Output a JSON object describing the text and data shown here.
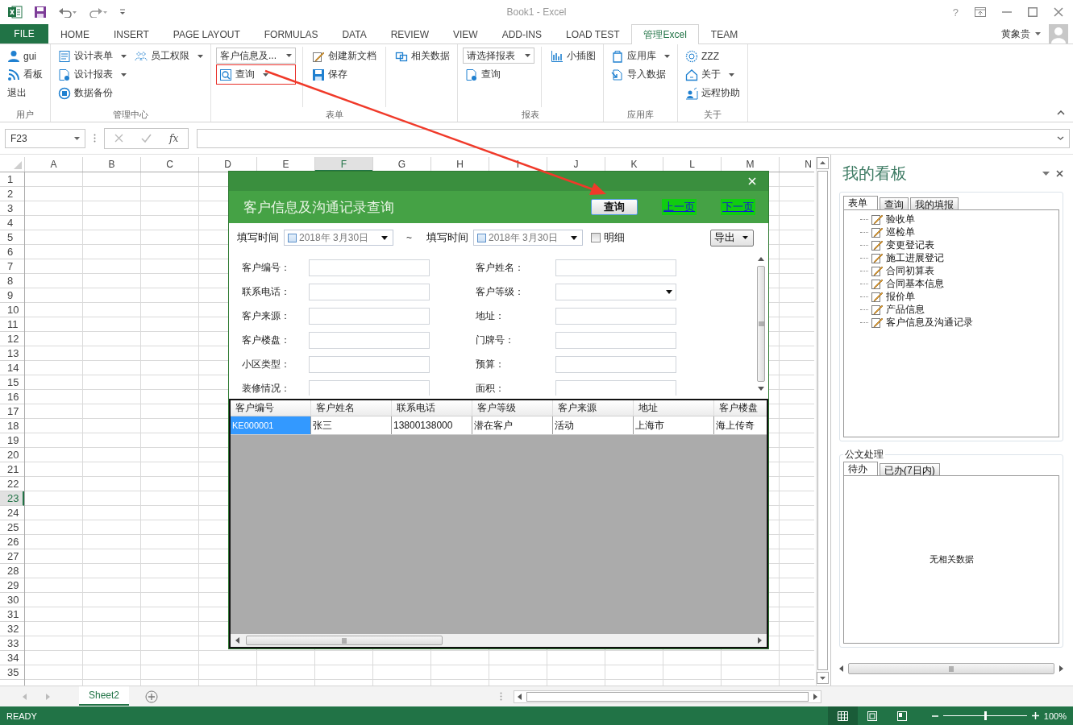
{
  "window": {
    "title": "Book1 - Excel",
    "help": "?"
  },
  "ribbon_tabs": [
    {
      "label": "FILE",
      "kind": "backstage",
      "selected": false
    },
    {
      "label": "HOME",
      "kind": "tab",
      "selected": false
    },
    {
      "label": "INSERT",
      "kind": "tab",
      "selected": false
    },
    {
      "label": "PAGE LAYOUT",
      "kind": "tab",
      "selected": false
    },
    {
      "label": "FORMULAS",
      "kind": "tab",
      "selected": false
    },
    {
      "label": "DATA",
      "kind": "tab",
      "selected": false
    },
    {
      "label": "REVIEW",
      "kind": "tab",
      "selected": false
    },
    {
      "label": "VIEW",
      "kind": "tab",
      "selected": false
    },
    {
      "label": "ADD-INS",
      "kind": "tab",
      "selected": false
    },
    {
      "label": "LOAD TEST",
      "kind": "tab",
      "selected": false
    },
    {
      "label": "管理Excel",
      "kind": "tab",
      "selected": true
    },
    {
      "label": "TEAM",
      "kind": "tab",
      "selected": false
    }
  ],
  "account": {
    "name": "黄象贵"
  },
  "ribbon_groups": [
    {
      "label": "用户",
      "columns": [
        [
          {
            "kind": "button",
            "label": "gui",
            "has_menu": false
          },
          {
            "kind": "button",
            "label": "看板",
            "has_menu": false
          },
          {
            "kind": "button",
            "label": "退出",
            "has_menu": false
          }
        ]
      ]
    },
    {
      "label": "管理中心",
      "column_dividers": false,
      "columns": [
        [
          {
            "kind": "button",
            "label": "设计表单",
            "has_menu": true
          },
          {
            "kind": "button",
            "label": "设计报表",
            "has_menu": true
          },
          {
            "kind": "button",
            "label": "数据备份",
            "has_menu": false
          }
        ],
        [
          {
            "kind": "button",
            "label": "员工权限",
            "has_menu": true
          }
        ]
      ]
    },
    {
      "label": "表单",
      "column_dividers": true,
      "columns": [
        [
          {
            "kind": "combo",
            "label": "客户信息及...",
            "has_menu": true
          },
          {
            "kind": "button",
            "label": "查询",
            "has_menu": true
          }
        ],
        [
          {
            "kind": "button",
            "label": "创建新文档",
            "has_menu": false
          },
          {
            "kind": "button",
            "label": "保存",
            "has_menu": false
          }
        ],
        [
          {
            "kind": "button",
            "label": "相关数据",
            "has_menu": false
          }
        ]
      ]
    },
    {
      "label": "报表",
      "column_dividers": true,
      "columns": [
        [
          {
            "kind": "combo",
            "label": "请选择报表",
            "has_menu": true
          },
          {
            "kind": "button",
            "label": "查询",
            "has_menu": false
          }
        ],
        [
          {
            "kind": "button",
            "label": "小插图",
            "has_menu": false
          }
        ]
      ]
    },
    {
      "label": "应用库",
      "columns": [
        [
          {
            "kind": "button",
            "label": "应用库",
            "has_menu": true
          },
          {
            "kind": "button",
            "label": "导入数据",
            "has_menu": false
          }
        ]
      ]
    },
    {
      "label": "关于",
      "columns": [
        [
          {
            "kind": "button",
            "label": "ZZZ",
            "has_menu": false
          },
          {
            "kind": "button",
            "label": "关于",
            "has_menu": true
          },
          {
            "kind": "button",
            "label": "远程协助",
            "has_menu": false
          }
        ]
      ]
    }
  ],
  "annotation": {
    "shown": true
  },
  "formula_bar": {
    "cell_name": "F23",
    "function_label": "fx"
  },
  "sheet": {
    "columns": [
      {
        "label": "A",
        "selected": false
      },
      {
        "label": "B",
        "selected": false
      },
      {
        "label": "C",
        "selected": false
      },
      {
        "label": "D",
        "selected": false
      },
      {
        "label": "E",
        "selected": false
      },
      {
        "label": "F",
        "selected": true
      },
      {
        "label": "G",
        "selected": false
      },
      {
        "label": "H",
        "selected": false
      },
      {
        "label": "I",
        "selected": false
      },
      {
        "label": "J",
        "selected": false
      },
      {
        "label": "K",
        "selected": false
      },
      {
        "label": "L",
        "selected": false
      },
      {
        "label": "M",
        "selected": false
      },
      {
        "label": "N",
        "selected": false
      }
    ],
    "rows": [
      {
        "label": "1",
        "selected": false
      },
      {
        "label": "2",
        "selected": false
      },
      {
        "label": "3",
        "selected": false
      },
      {
        "label": "4",
        "selected": false
      },
      {
        "label": "5",
        "selected": false
      },
      {
        "label": "6",
        "selected": false
      },
      {
        "label": "7",
        "selected": false
      },
      {
        "label": "8",
        "selected": false
      },
      {
        "label": "9",
        "selected": false
      },
      {
        "label": "10",
        "selected": false
      },
      {
        "label": "11",
        "selected": false
      },
      {
        "label": "12",
        "selected": false
      },
      {
        "label": "13",
        "selected": false
      },
      {
        "label": "14",
        "selected": false
      },
      {
        "label": "15",
        "selected": false
      },
      {
        "label": "16",
        "selected": false
      },
      {
        "label": "17",
        "selected": false
      },
      {
        "label": "18",
        "selected": false
      },
      {
        "label": "19",
        "selected": false
      },
      {
        "label": "20",
        "selected": false
      },
      {
        "label": "21",
        "selected": false
      },
      {
        "label": "22",
        "selected": false
      },
      {
        "label": "23",
        "selected": true
      },
      {
        "label": "24",
        "selected": false
      },
      {
        "label": "25",
        "selected": false
      },
      {
        "label": "26",
        "selected": false
      },
      {
        "label": "27",
        "selected": false
      },
      {
        "label": "28",
        "selected": false
      },
      {
        "label": "29",
        "selected": false
      },
      {
        "label": "30",
        "selected": false
      },
      {
        "label": "31",
        "selected": false
      },
      {
        "label": "32",
        "selected": false
      },
      {
        "label": "33",
        "selected": false
      },
      {
        "label": "34",
        "selected": false
      },
      {
        "label": "35",
        "selected": false
      }
    ]
  },
  "dialog": {
    "title": "客户信息及沟通记录查询",
    "query_button": "查询",
    "prev_link": "上一页",
    "next_link": "下一页",
    "date_filters": [
      {
        "label": "填写时间",
        "value": "2018年  3月30日",
        "checked": false
      },
      {
        "label": "填写时间",
        "value": "2018年  3月30日",
        "checked": false
      }
    ],
    "range_separator": "~",
    "detail_checkbox": {
      "label": "明细",
      "checked": false
    },
    "export_button": "导出",
    "field_rows": [
      [
        {
          "label": "客户编号：",
          "kind": "text"
        },
        {
          "label": "客户姓名：",
          "kind": "text"
        }
      ],
      [
        {
          "label": "联系电话：",
          "kind": "text"
        },
        {
          "label": "客户等级：",
          "kind": "select"
        }
      ],
      [
        {
          "label": "客户来源：",
          "kind": "text"
        },
        {
          "label": "地址：",
          "kind": "text"
        }
      ],
      [
        {
          "label": "客户楼盘：",
          "kind": "text"
        },
        {
          "label": "门牌号：",
          "kind": "text"
        }
      ],
      [
        {
          "label": "小区类型：",
          "kind": "text"
        },
        {
          "label": "预算：",
          "kind": "text"
        }
      ],
      [
        {
          "label": "装修情况：",
          "kind": "text"
        },
        {
          "label": "面积：",
          "kind": "text"
        }
      ]
    ],
    "table": {
      "columns": [
        "客户编号",
        "客户姓名",
        "联系电话",
        "客户等级",
        "客户来源",
        "地址",
        "客户楼盘"
      ],
      "rows": [
        {
          "cells": [
            {
              "text": "KE000001",
              "selected": true
            },
            {
              "text": "张三",
              "selected": false
            },
            {
              "text": "13800138000",
              "selected": false
            },
            {
              "text": "潜在客户",
              "selected": false
            },
            {
              "text": "活动",
              "selected": false
            },
            {
              "text": "上海市",
              "selected": false
            },
            {
              "text": "海上传奇",
              "selected": false
            }
          ]
        }
      ]
    }
  },
  "task_pane": {
    "title": "我的看板",
    "form_tabs": [
      {
        "label": "表单",
        "selected": true
      },
      {
        "label": "查询",
        "selected": false
      },
      {
        "label": "我的填报",
        "selected": false
      }
    ],
    "tree": [
      {
        "label": "验收单"
      },
      {
        "label": "巡检单"
      },
      {
        "label": "变更登记表"
      },
      {
        "label": "施工进展登记"
      },
      {
        "label": "合同初算表"
      },
      {
        "label": "合同基本信息"
      },
      {
        "label": "报价单"
      },
      {
        "label": "产品信息"
      },
      {
        "label": "客户信息及沟通记录"
      }
    ],
    "documents": {
      "title": "公文处理",
      "tabs": [
        {
          "label": "待办",
          "selected": true
        },
        {
          "label": "已办(7日内)",
          "selected": false
        }
      ],
      "empty_text": "无相关数据"
    }
  },
  "sheet_tabs": [
    {
      "label": "Sheet2",
      "selected": true
    }
  ],
  "status_bar": {
    "status": "READY",
    "views": [
      {
        "selected": true
      },
      {
        "selected": false
      },
      {
        "selected": false
      }
    ],
    "zoom": {
      "level": 0.5,
      "reading": "100%"
    }
  }
}
